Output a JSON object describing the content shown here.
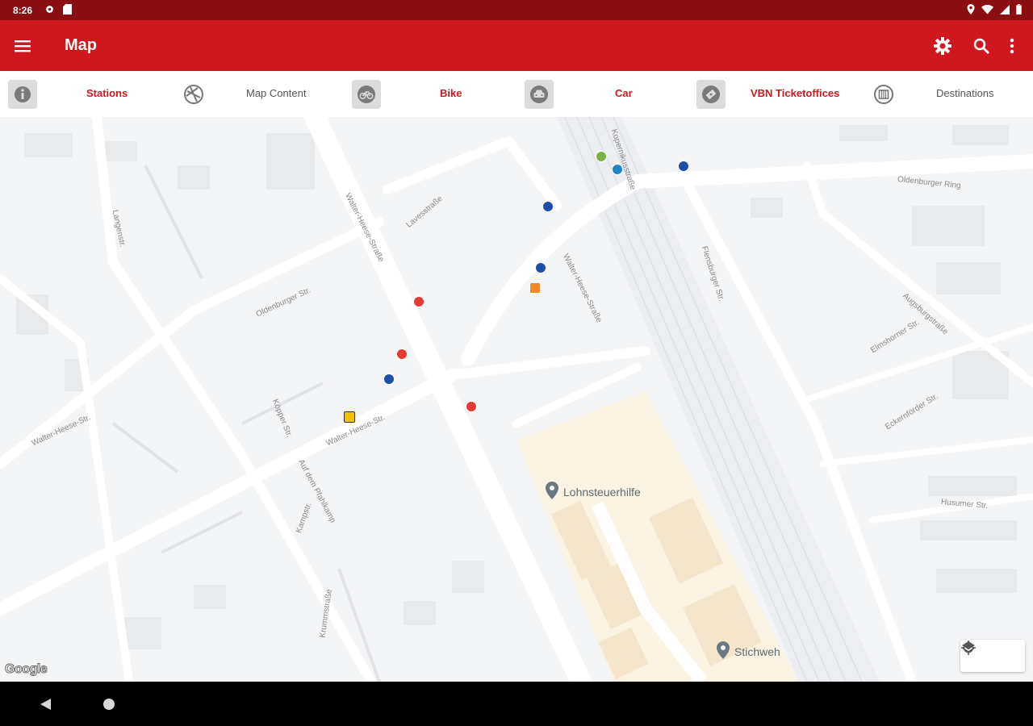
{
  "status": {
    "time": "8:26"
  },
  "appbar": {
    "title": "Map"
  },
  "filters": [
    {
      "label": "Stations",
      "icon": "info-icon"
    },
    {
      "label": "Map Content",
      "icon": "layers-icon"
    },
    {
      "label": "Bike",
      "icon": "bike-icon"
    },
    {
      "label": "Car",
      "icon": "car-icon"
    },
    {
      "label": "VBN Ticketoffices",
      "icon": "ticket-icon"
    },
    {
      "label": "Destinations",
      "icon": "building-icon"
    }
  ],
  "map": {
    "pois": [
      {
        "label": "Lohnsteuerhilfe"
      },
      {
        "label": "Stichweh"
      }
    ],
    "streets": [
      "Walter-Heese-Straße",
      "Lavesstraße",
      "Oldenburger Str.",
      "Langenstr.",
      "Walter-Heese-Straße",
      "Oldenburger Ring",
      "Walter-Heese-Str.",
      "Kopernikusstraße",
      "Flensburger Str.",
      "Augsburgstraße",
      "Elmshorner Str.",
      "Eckernförder Str.",
      "Husumer Str.",
      "Köpper Str.",
      "Auf dem Pfahlkamp",
      "Kampstr.",
      "Walter-Heese-Str.",
      "Krummstraße"
    ],
    "attribution": "Google"
  },
  "colors": {
    "primary": "#d0171d",
    "statusbar": "#8b0e10"
  }
}
